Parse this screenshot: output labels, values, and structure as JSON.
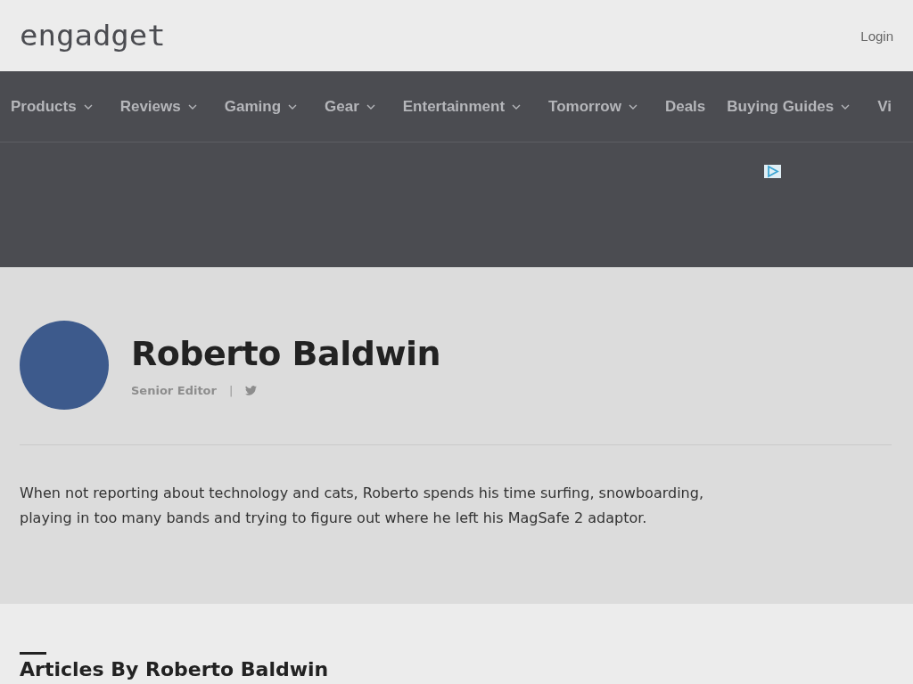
{
  "header": {
    "logo": "engadget",
    "login": "Login"
  },
  "nav": [
    {
      "label": "Products",
      "has_menu": true
    },
    {
      "label": "Reviews",
      "has_menu": true
    },
    {
      "label": "Gaming",
      "has_menu": true
    },
    {
      "label": "Gear",
      "has_menu": true
    },
    {
      "label": "Entertainment",
      "has_menu": true
    },
    {
      "label": "Tomorrow",
      "has_menu": true
    },
    {
      "label": "Deals",
      "has_menu": false
    },
    {
      "label": "Buying Guides",
      "has_menu": true
    },
    {
      "label": "Vi",
      "has_menu": false
    }
  ],
  "author": {
    "name": "Roberto Baldwin",
    "role": "Senior Editor",
    "separator": "|",
    "bio": "When not reporting about technology and cats, Roberto spends his time surfing, snowboarding, playing in too many bands and trying to figure out where he left his MagSafe 2 adaptor."
  },
  "articles": {
    "heading": "Articles By Roberto Baldwin"
  }
}
